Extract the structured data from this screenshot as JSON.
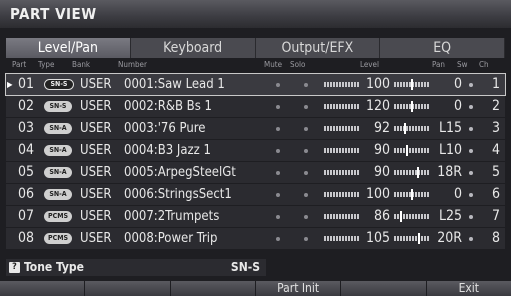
{
  "title": "PART VIEW",
  "tabs": [
    "Level/Pan",
    "Keyboard",
    "Output/EFX",
    "EQ"
  ],
  "columns": {
    "part": "Part",
    "type": "Type",
    "bank": "Bank",
    "number": "Number",
    "mute": "Mute",
    "solo": "Solo",
    "level": "Level",
    "pan": "Pan",
    "sw": "Sw",
    "ch": "Ch"
  },
  "rows": [
    {
      "part": "01",
      "type": "SN-S",
      "bank": "USER",
      "number": "0001:Saw Lead 1",
      "level": "100",
      "pan": "0",
      "ch": "1"
    },
    {
      "part": "02",
      "type": "SN-S",
      "bank": "USER",
      "number": "0002:R&B Bs 1",
      "level": "120",
      "pan": "0",
      "ch": "2"
    },
    {
      "part": "03",
      "type": "SN-A",
      "bank": "USER",
      "number": "0003:'76 Pure",
      "level": "92",
      "pan": "L15",
      "ch": "3"
    },
    {
      "part": "04",
      "type": "SN-A",
      "bank": "USER",
      "number": "0004:B3 Jazz 1",
      "level": "90",
      "pan": "L10",
      "ch": "4"
    },
    {
      "part": "05",
      "type": "SN-A",
      "bank": "USER",
      "number": "0005:ArpegSteelGt",
      "level": "90",
      "pan": "18R",
      "ch": "5"
    },
    {
      "part": "06",
      "type": "SN-A",
      "bank": "USER",
      "number": "0006:StringsSect1",
      "level": "100",
      "pan": "0",
      "ch": "6"
    },
    {
      "part": "07",
      "type": "PCMS",
      "bank": "USER",
      "number": "0007:2Trumpets",
      "level": "86",
      "pan": "L25",
      "ch": "7"
    },
    {
      "part": "08",
      "type": "PCMS",
      "bank": "USER",
      "number": "0008:Power Trip",
      "level": "105",
      "pan": "20R",
      "ch": "8"
    }
  ],
  "info": {
    "label": "Tone Type",
    "value": "SN-S"
  },
  "funcbar": [
    "",
    "",
    "",
    "Part Init",
    "",
    "Exit"
  ]
}
